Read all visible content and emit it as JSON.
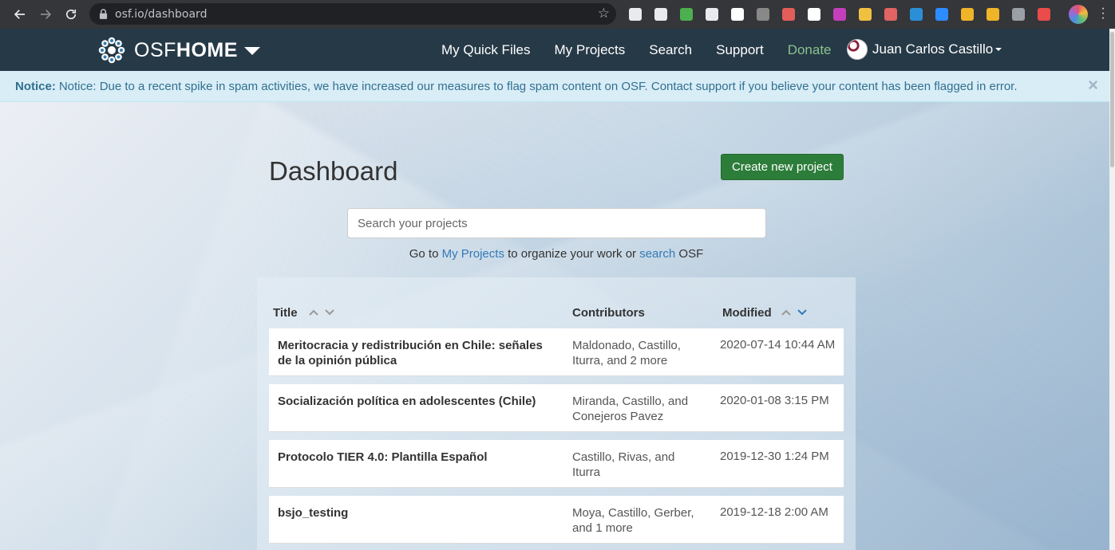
{
  "browser": {
    "url": "osf.io/dashboard",
    "extensions": [
      {
        "name": "docs-icon",
        "color": "#e8eaed"
      },
      {
        "name": "shield-icon",
        "color": "#e8eaed"
      },
      {
        "name": "image-icon",
        "color": "#4caf50"
      },
      {
        "name": "s-icon",
        "color": "#e8eaed"
      },
      {
        "name": "lock-ext-icon",
        "color": "#ffffff"
      },
      {
        "name": "h-icon",
        "color": "#888888"
      },
      {
        "name": "arrow-ext-icon",
        "color": "#e35d5b"
      },
      {
        "name": "gnu-icon",
        "color": "#ffffff"
      },
      {
        "name": "color-grid-icon",
        "color": "#c53fbd"
      },
      {
        "name": "pen-icon",
        "color": "#f0c040"
      },
      {
        "name": "tag-icon",
        "color": "#e06464"
      },
      {
        "name": "feather-icon",
        "color": "#2a8fd6"
      },
      {
        "name": "zoom-icon",
        "color": "#2d8cff"
      },
      {
        "name": "crown-icon",
        "color": "#f0b429"
      },
      {
        "name": "crown2-icon",
        "color": "#f0b429"
      },
      {
        "name": "circle-ext-icon",
        "color": "#9aa0a6"
      },
      {
        "name": "swirl-icon",
        "color": "#ea4b4b"
      }
    ]
  },
  "navbar": {
    "brand_osf": "OSF",
    "brand_home": "HOME",
    "links": [
      {
        "label": "My Quick Files"
      },
      {
        "label": "My Projects"
      },
      {
        "label": "Search"
      },
      {
        "label": "Support"
      },
      {
        "label": "Donate"
      }
    ],
    "user_name": "Juan Carlos Castillo"
  },
  "notice": {
    "label": "Notice:",
    "text": "Notice: Due to a recent spike in spam activities, we have increased our measures to flag spam content on OSF. Contact support if you believe your content has been flagged in error.",
    "close": "×"
  },
  "dashboard": {
    "title": "Dashboard",
    "create_button": "Create new project",
    "search_placeholder": "Search your projects",
    "goto_prefix": "Go to",
    "goto_my_projects": "My Projects",
    "goto_middle": "to organize your work or",
    "goto_search": "search",
    "goto_suffix": "OSF"
  },
  "table": {
    "headers": {
      "title": "Title",
      "contributors": "Contributors",
      "modified": "Modified"
    },
    "rows": [
      {
        "title": "Meritocracia y redistribución en Chile: señales de la opinión pública",
        "contributors": "Maldonado, Castillo, Iturra, and 2 more",
        "modified": "2020-07-14 10:44 AM"
      },
      {
        "title": "Socialización política en adolescentes (Chile)",
        "contributors": "Miranda, Castillo, and Conejeros Pavez",
        "modified": "2020-01-08 3:15 PM"
      },
      {
        "title": "Protocolo TIER 4.0: Plantilla Español",
        "contributors": "Castillo, Rivas, and Iturra",
        "modified": "2019-12-30 1:24 PM"
      },
      {
        "title": "bsjo_testing",
        "contributors": "Moya, Castillo, Gerber, and 1 more",
        "modified": "2019-12-18 2:00 AM"
      }
    ]
  }
}
